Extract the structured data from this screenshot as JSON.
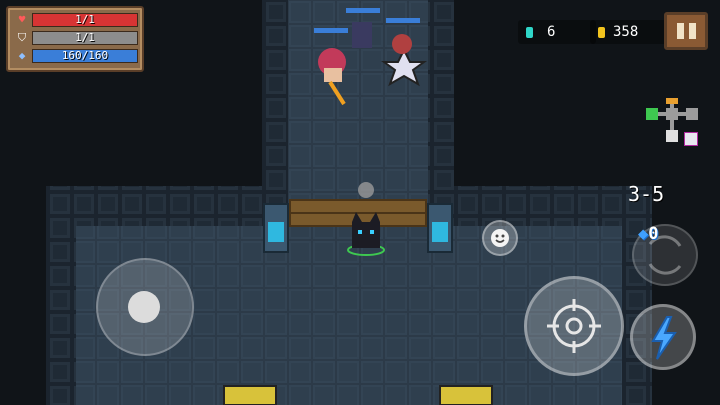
{
  "hud": {
    "health": {
      "text": "1/1",
      "fraction": 1.0
    },
    "armor": {
      "text": "1/1",
      "fraction": 1.0
    },
    "energy": {
      "text": "160/160",
      "fraction": 1.0
    }
  },
  "currency": {
    "gems": "6",
    "gold": "358"
  },
  "level": "3-5",
  "weapon_ammo": "0",
  "colors": {
    "health": "#d83434",
    "armor": "#8d8d8d",
    "energy": "#3a7ed8",
    "gem": "#2fd6c8",
    "gold": "#f2c41e"
  },
  "icons": {
    "health": "heart-icon",
    "armor": "shield-icon",
    "energy": "diamond-icon",
    "pause": "pause-icon",
    "attack": "crosshair-icon",
    "skill": "lightning-icon",
    "emote": "smiley-icon",
    "swap": "weapon-swap-icon"
  }
}
